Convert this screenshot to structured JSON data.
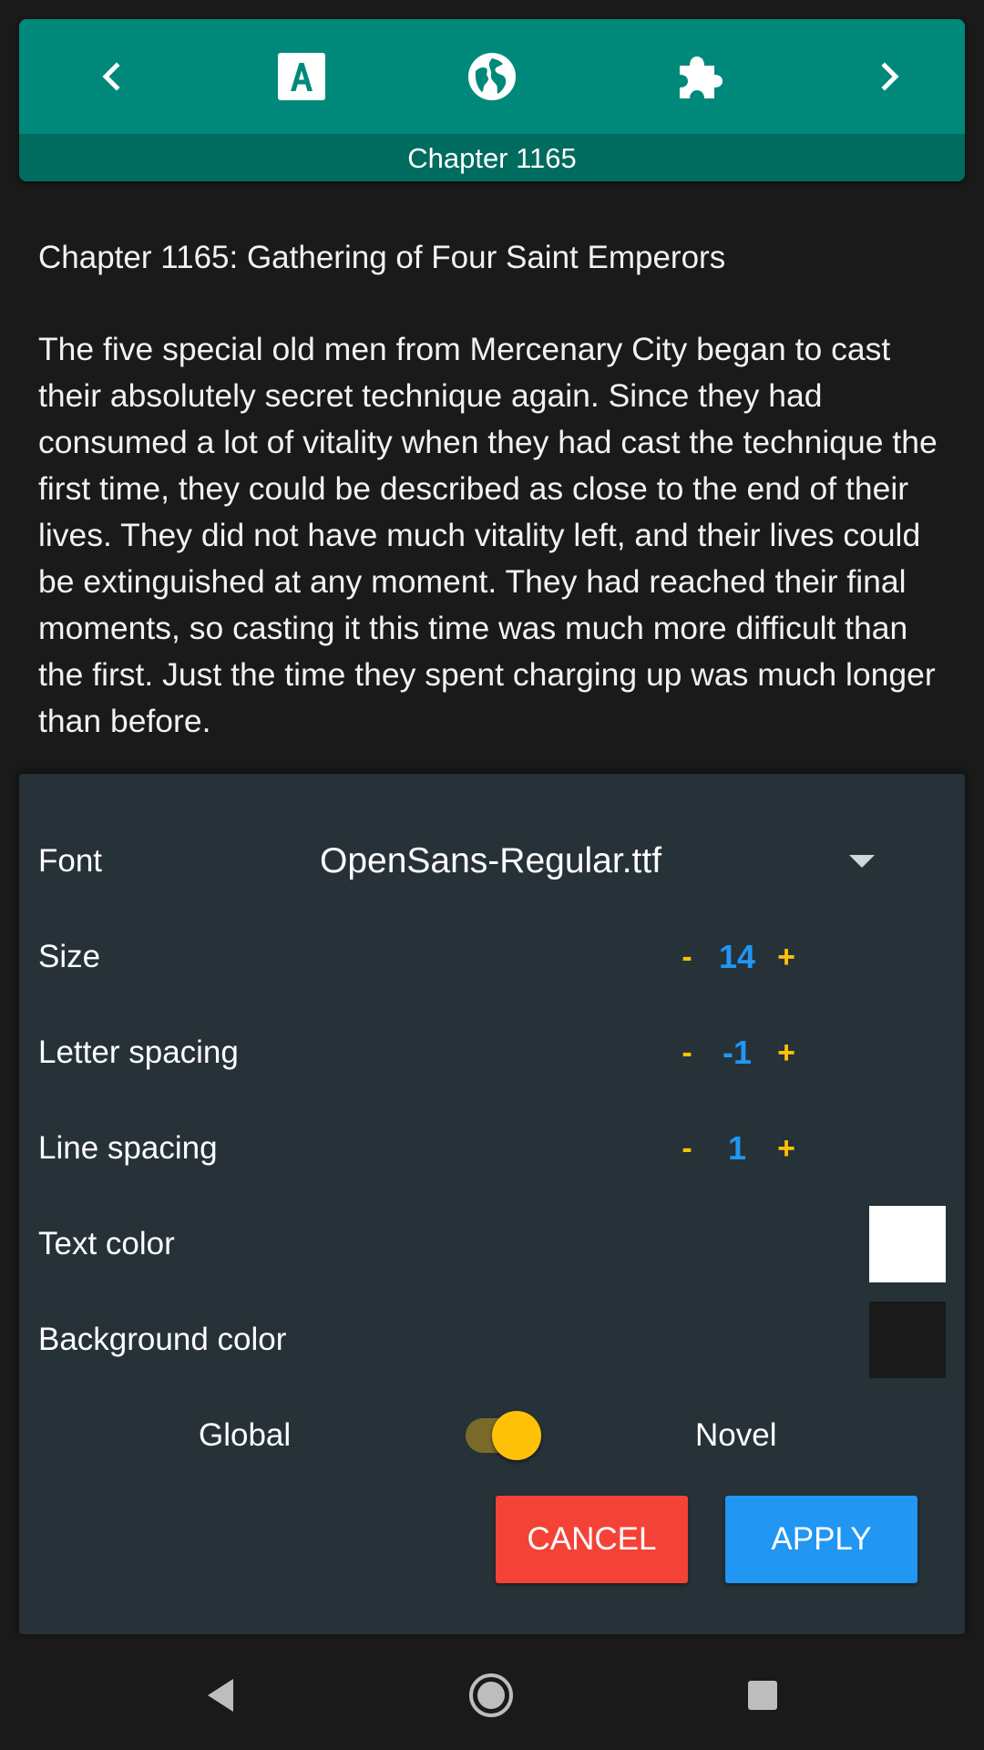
{
  "toolbar": {
    "chapter_label": "Chapter 1165",
    "icons": [
      "chevron-left-icon",
      "font-icon",
      "globe-icon",
      "puzzle-icon",
      "chevron-right-icon"
    ]
  },
  "content": {
    "title": "Chapter 1165: Gathering of Four Saint Emperors",
    "paragraph": "The five special old men from Mercenary City began to cast their absolutely secret technique again. Since they had consumed a lot of vitality when they had cast the technique the first time, they could be described as close to the end of their lives. They did not have much vitality left, and their lives could be extinguished at any moment. They had reached their final moments, so casting it this time was much more difficult than the first. Just the time they spent charging up was much longer than before."
  },
  "settings": {
    "font": {
      "label": "Font",
      "value": "OpenSans-Regular.ttf"
    },
    "size": {
      "label": "Size",
      "minus": "-",
      "value": "14",
      "plus": "+"
    },
    "letter_spacing": {
      "label": "Letter spacing",
      "minus": "-",
      "value": "-1",
      "plus": "+"
    },
    "line_spacing": {
      "label": "Line spacing",
      "minus": "-",
      "value": "1",
      "plus": "+"
    },
    "text_color": {
      "label": "Text color",
      "color": "#ffffff"
    },
    "background_color": {
      "label": "Background color",
      "color": "#1a1a1a"
    },
    "scope": {
      "left_label": "Global",
      "right_label": "Novel",
      "selected": "Novel"
    },
    "cancel_label": "CANCEL",
    "apply_label": "APPLY"
  },
  "colors": {
    "toolbar": "#00897b",
    "accent": "#ffc107",
    "value": "#2196f3",
    "cancel": "#f44336",
    "apply": "#2196f3",
    "panel": "#263238"
  }
}
